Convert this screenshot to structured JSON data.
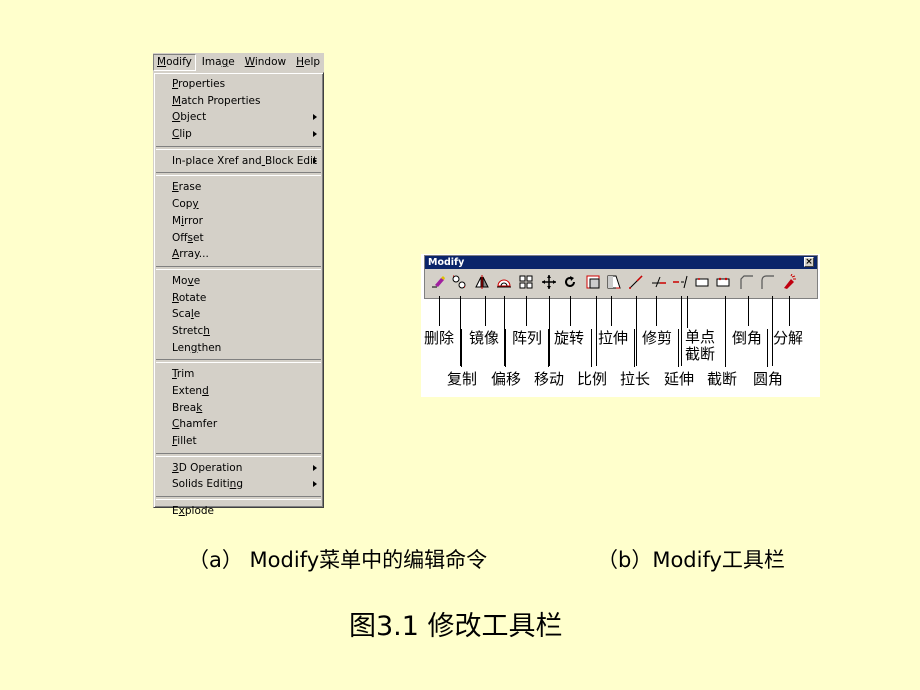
{
  "menu": {
    "menubar": [
      {
        "label": "Modify",
        "u": 0,
        "active": true
      },
      {
        "label": "Image",
        "u": 3,
        "active": false
      },
      {
        "label": "Window",
        "u": 0,
        "active": false
      },
      {
        "label": "Help",
        "u": 0,
        "active": false
      }
    ],
    "groups": [
      [
        {
          "label": "Properties",
          "u": 0,
          "submenu": false
        },
        {
          "label": "Match Properties",
          "u": 0,
          "submenu": false
        },
        {
          "label": "Object",
          "u": 0,
          "submenu": true
        },
        {
          "label": "Clip",
          "u": 0,
          "submenu": true
        }
      ],
      [
        {
          "label": "In-place Xref and Block Edit",
          "u": 17,
          "submenu": true
        }
      ],
      [
        {
          "label": "Erase",
          "u": 0,
          "submenu": false
        },
        {
          "label": "Copy",
          "u": 3,
          "submenu": false
        },
        {
          "label": "Mirror",
          "u": 1,
          "submenu": false
        },
        {
          "label": "Offset",
          "u": 3,
          "submenu": false
        },
        {
          "label": "Array...",
          "u": 0,
          "submenu": false
        }
      ],
      [
        {
          "label": "Move",
          "u": 2,
          "submenu": false
        },
        {
          "label": "Rotate",
          "u": 0,
          "submenu": false
        },
        {
          "label": "Scale",
          "u": 3,
          "submenu": false
        },
        {
          "label": "Stretch",
          "u": 6,
          "submenu": false
        },
        {
          "label": "Lengthen",
          "u": 3,
          "submenu": false
        }
      ],
      [
        {
          "label": "Trim",
          "u": 0,
          "submenu": false
        },
        {
          "label": "Extend",
          "u": 5,
          "submenu": false
        },
        {
          "label": "Break",
          "u": 4,
          "submenu": false
        },
        {
          "label": "Chamfer",
          "u": 0,
          "submenu": false
        },
        {
          "label": "Fillet",
          "u": 0,
          "submenu": false
        }
      ],
      [
        {
          "label": "3D Operation",
          "u": 0,
          "submenu": true
        },
        {
          "label": "Solids Editing",
          "u": 12,
          "submenu": true
        }
      ],
      [
        {
          "label": "Explode",
          "u": 1,
          "submenu": false
        }
      ]
    ]
  },
  "toolbar": {
    "title": "Modify",
    "close_glyph": "×",
    "tools": [
      {
        "icon": "erase-icon",
        "label": "删除",
        "row": 1
      },
      {
        "icon": "copy-icon",
        "label": "复制",
        "row": 2
      },
      {
        "icon": "mirror-icon",
        "label": "镜像",
        "row": 1
      },
      {
        "icon": "offset-icon",
        "label": "偏移",
        "row": 2
      },
      {
        "icon": "array-icon",
        "label": "阵列",
        "row": 1
      },
      {
        "icon": "move-icon",
        "label": "移动",
        "row": 2
      },
      {
        "icon": "rotate-icon",
        "label": "旋转",
        "row": 1
      },
      {
        "icon": "scale-icon",
        "label": "比例",
        "row": 2
      },
      {
        "icon": "stretch-icon",
        "label": "拉伸",
        "row": 1
      },
      {
        "icon": "lengthen-icon",
        "label": "拉长",
        "row": 2
      },
      {
        "icon": "trim-icon",
        "label": "修剪",
        "row": 1
      },
      {
        "icon": "extend-icon",
        "label": "延伸",
        "row": 2
      },
      {
        "icon": "break-at-point-icon",
        "label": "单点截断",
        "row": 1
      },
      {
        "icon": "break-icon",
        "label": "截断",
        "row": 2
      },
      {
        "icon": "chamfer-icon",
        "label": "倒角",
        "row": 1
      },
      {
        "icon": "fillet-icon",
        "label": "圆角",
        "row": 2
      },
      {
        "icon": "explode-icon",
        "label": "分解",
        "row": 1
      }
    ]
  },
  "captions": {
    "a": "（a） Modify菜单中的编辑命令",
    "b": "（b）Modify工具栏",
    "figure_title": "图3.1  修改工具栏"
  }
}
